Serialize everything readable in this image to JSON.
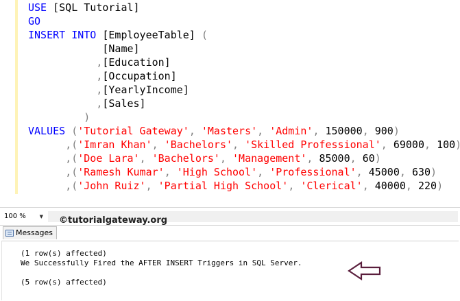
{
  "editor": {
    "lines": [
      {
        "kw1": "USE ",
        "plain": "[SQL Tutorial]"
      },
      {
        "kw1": "GO"
      },
      {
        "kw1": "INSERT INTO ",
        "plain": "[EmployeeTable] ",
        "grey": "("
      },
      {
        "indent": "            ",
        "plain": "[Name]"
      },
      {
        "indent": "           ",
        "grey": ",",
        "plain": "[Education]"
      },
      {
        "indent": "           ",
        "grey": ",",
        "plain": "[Occupation]"
      },
      {
        "indent": "           ",
        "grey": ",",
        "plain": "[YearlyIncome]"
      },
      {
        "indent": "           ",
        "grey": ",",
        "plain": "[Sales]"
      },
      {
        "indent": "         ",
        "grey": ")"
      },
      {
        "kw1": "VALUES ",
        "row": [
          "'Tutorial Gateway'",
          "'Masters'",
          "'Admin'",
          "150000",
          "900"
        ]
      },
      {
        "indent": "      ",
        "lead": ",",
        "row": [
          "'Imran Khan'",
          "'Bachelors'",
          "'Skilled Professional'",
          "69000",
          "100"
        ]
      },
      {
        "indent": "      ",
        "lead": ",",
        "row": [
          "'Doe Lara'",
          "'Bachelors'",
          "'Management'",
          "85000",
          "60"
        ]
      },
      {
        "indent": "      ",
        "lead": ",",
        "row": [
          "'Ramesh Kumar'",
          "'High School'",
          "'Professional'",
          "45000",
          "630"
        ]
      },
      {
        "indent": "      ",
        "lead": ",",
        "row": [
          "'John Ruiz'",
          "'Partial High School'",
          "'Clerical'",
          "40000",
          "220"
        ]
      }
    ]
  },
  "status": {
    "zoom": "100 %",
    "watermark": "©tutorialgateway.org"
  },
  "results": {
    "tab_label": "Messages",
    "messages": [
      "(1 row(s) affected)",
      "We Successfully Fired the AFTER INSERT Triggers in SQL Server.",
      "",
      "(5 row(s) affected)"
    ]
  },
  "colors": {
    "keyword": "#0000ff",
    "string": "#ff0000",
    "operator": "#808080",
    "margin_highlight": "#fef3b7",
    "arrow": "#5a1e3c"
  }
}
